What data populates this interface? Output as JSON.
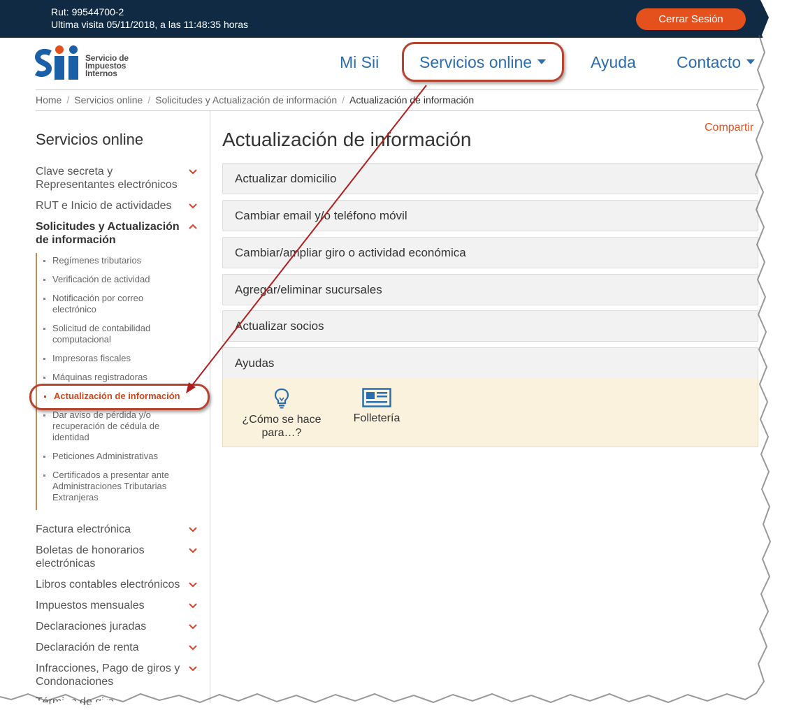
{
  "topbar": {
    "rut": "Rut: 99544700-2",
    "last_visit": "Ultima visita 05/11/2018, a las 11:48:35 horas",
    "logout_label": "Cerrar Sesión"
  },
  "logo": {
    "line1": "Servicio de",
    "line2": "Impuestos",
    "line3": "Internos"
  },
  "nav": {
    "items": [
      {
        "label": "Mi Sii"
      },
      {
        "label": "Servicios online"
      },
      {
        "label": "Ayuda"
      },
      {
        "label": "Contacto"
      }
    ]
  },
  "breadcrumb": {
    "items": [
      "Home",
      "Servicios online",
      "Solicitudes y Actualización de información",
      "Actualización de información"
    ]
  },
  "sidebar": {
    "title": "Servicios online",
    "items": [
      {
        "label": "Clave secreta y Representantes electrónicos"
      },
      {
        "label": "RUT e Inicio de actividades"
      },
      {
        "label": "Solicitudes y Actualización de información"
      },
      {
        "label": "Factura electrónica"
      },
      {
        "label": "Boletas de honorarios electrónicas"
      },
      {
        "label": "Libros contables electrónicos"
      },
      {
        "label": "Impuestos mensuales"
      },
      {
        "label": "Declaraciones juradas"
      },
      {
        "label": "Declaración de renta"
      },
      {
        "label": "Infracciones, Pago de giros y Condonaciones"
      },
      {
        "label": "Término de giro"
      }
    ],
    "subitems": [
      {
        "label": "Regímenes tributarios"
      },
      {
        "label": "Verificación de actividad"
      },
      {
        "label": "Notificación por correo electrónico"
      },
      {
        "label": "Solicitud de contabilidad computacional"
      },
      {
        "label": "Impresoras fiscales"
      },
      {
        "label": "Máquinas registradoras"
      },
      {
        "label": "Actualización de información"
      },
      {
        "label": "Dar aviso de pérdida y/o recuperación de cédula de identidad"
      },
      {
        "label": "Peticiones Administrativas"
      },
      {
        "label": "Certificados a presentar ante Administraciones Tributarias Extranjeras"
      }
    ]
  },
  "content": {
    "share_label": "Compartir",
    "title": "Actualización de información",
    "accordion": [
      {
        "label": "Actualizar domicilio"
      },
      {
        "label": "Cambiar email y/o teléfono móvil"
      },
      {
        "label": "Cambiar/ampliar giro o actividad económica"
      },
      {
        "label": "Agregar/eliminar sucursales"
      },
      {
        "label": "Actualizar socios"
      },
      {
        "label": "Ayudas"
      }
    ],
    "help": [
      {
        "label": "¿Cómo se hace para…?",
        "icon": "lightbulb-icon"
      },
      {
        "label": "Folletería",
        "icon": "newspaper-icon"
      }
    ]
  },
  "colors": {
    "topbar_bg": "#102a43",
    "accent_orange": "#e5511d",
    "nav_blue": "#2a6eb0",
    "annotation_red": "#b5432d",
    "help_panel_bg": "#fbf2dd"
  }
}
